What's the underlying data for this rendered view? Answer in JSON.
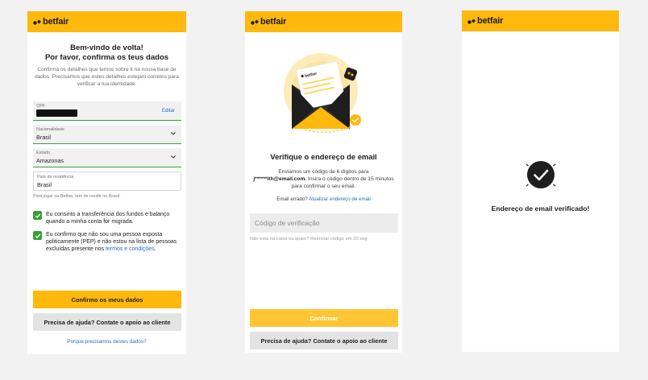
{
  "brand": {
    "name": "betfair",
    "color": "#ffb80c",
    "accent_green": "#37a037",
    "link_blue": "#1f6ec7"
  },
  "screen1": {
    "title_line1": "Bem-vindo de volta!",
    "title_line2": "Por favor, confirma os teus dados",
    "description": "Confirma os detalhes que temos sobre ti na nossa base de dados. Precisamos que estes detalhes estejam corretos para verificar a tua identidade.",
    "cpf": {
      "label": "CPF",
      "value_masked": true,
      "action": "Editar"
    },
    "nationality": {
      "label": "Nacionalidade",
      "value": "Brasil"
    },
    "state": {
      "label": "Estado",
      "value": "Amazonas"
    },
    "residence": {
      "label": "País de residência",
      "value": "Brasil"
    },
    "residence_hint": "Para jogar na Betfair, tem de residir no Brasil.",
    "consent1": {
      "checked": true,
      "text": "Eu consinto a transferência dos fundos e balanço quando a minha conta for migrada."
    },
    "consent2": {
      "checked": true,
      "text": "Eu confirmo que não sou uma pessoa exposta politicamente (PEP) e não estou na lista de pessoas excluídas presente nos ",
      "link": "termos e condições",
      "suffix": "."
    },
    "confirm_button": "Confirmo os meus dados",
    "help_button": "Precisa de ajuda? Contate o apoio ao cliente",
    "why_link": "Porque precisamos destes dados?"
  },
  "screen2": {
    "title": "Verifique o endereço de email",
    "desc_before": "Enviamos um código de 6 dígitos para",
    "email": "j******ith@email.com.",
    "desc_after": "Insira o código dentro de 15 minutos para confirmar o seu email.",
    "wrong_email": "Email errado?",
    "update_link": "Atualizar endereço de email",
    "code_placeholder": "Código de verificação",
    "resend_text": "Não está na caixa ou spam? Reenviar código em 20 seg",
    "confirm_button": "Confirmar",
    "help_button": "Precisa de ajuda? Contate o apoio ao cliente",
    "envelope_logo": "betfair"
  },
  "screen3": {
    "title": "Endereço de email verificado!",
    "icon": "verified-badge-icon"
  }
}
